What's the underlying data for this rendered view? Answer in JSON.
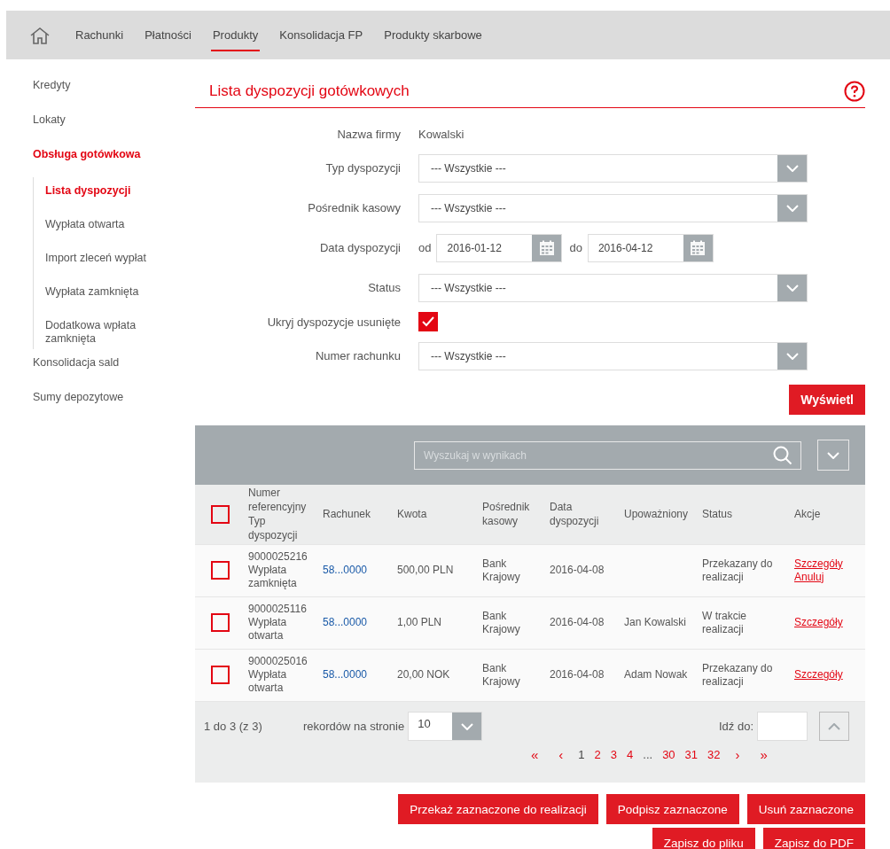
{
  "nav": {
    "tabs": [
      {
        "label": "Rachunki",
        "selected": false
      },
      {
        "label": "Płatności",
        "selected": false
      },
      {
        "label": "Produkty",
        "selected": true
      },
      {
        "label": "Konsolidacja FP",
        "selected": false
      },
      {
        "label": "Produkty skarbowe",
        "selected": false
      }
    ]
  },
  "sidebar": {
    "items": [
      {
        "label": "Kredyty",
        "selected": false
      },
      {
        "label": "Lokaty",
        "selected": false
      },
      {
        "label": "Obsługa gotówkowa",
        "selected": true,
        "expanded": true,
        "children": [
          {
            "label": "Lista dyspozycji",
            "selected": true
          },
          {
            "label": "Wypłata otwarta",
            "selected": false
          },
          {
            "label": "Import zleceń wypłat",
            "selected": false
          },
          {
            "label": "Wypłata zamknięta",
            "selected": false
          },
          {
            "label": "Dodatkowa wpłata zamknięta",
            "selected": false
          }
        ]
      },
      {
        "label": "Konsolidacja sald",
        "selected": false
      },
      {
        "label": "Sumy depozytowe",
        "selected": false
      }
    ]
  },
  "page_title": "Lista dyspozycji gotówkowych",
  "form": {
    "fields": [
      {
        "kind": "text",
        "label": "Nazwa firmy",
        "value": "Kowalski"
      },
      {
        "kind": "select",
        "label": "Typ dyspozycji",
        "value": "--- Wszystkie ---"
      },
      {
        "kind": "select",
        "label": "Pośrednik kasowy",
        "value": "--- Wszystkie ---"
      },
      {
        "kind": "daterange",
        "label": "Data dyspozycji",
        "from_label": "od",
        "from": "2016-01-12",
        "to_label": "do",
        "to": "2016-04-12"
      },
      {
        "kind": "select",
        "label": "Status",
        "value": "--- Wszystkie ---"
      },
      {
        "kind": "checkbox",
        "label": "Ukryj dyspozycje usunięte",
        "checked": true
      },
      {
        "kind": "select",
        "label": "Numer rachunku",
        "value": "--- Wszystkie ---"
      }
    ],
    "submit": "Wyświetl"
  },
  "results": {
    "search": {
      "placeholder": "Wyszukaj w wynikach"
    },
    "columns": [
      "Numer referencyjny Typ dyspozycji",
      "Rachunek",
      "Kwota",
      "Pośrednik kasowy",
      "Data dyspozycji",
      "Upoważniony",
      "Status",
      "Akcje"
    ],
    "header_checked": false,
    "rows": [
      {
        "checked": false,
        "reference": "9000025216",
        "type": "Wypłata zamknięta",
        "account": "58...0000",
        "amount": "500,00 PLN",
        "intermediary": "Bank Krajowy",
        "date": "2016-04-08",
        "authorized": "",
        "status": "Przekazany do realizacji",
        "actions": [
          "Szczegóły",
          "Anuluj"
        ]
      },
      {
        "checked": false,
        "reference": "9000025116",
        "type": "Wypłata otwarta",
        "account": "58...0000",
        "amount": "1,00 PLN",
        "intermediary": "Bank Krajowy",
        "date": "2016-04-08",
        "authorized": "Jan Kowalski",
        "status": "W trakcie realizacji",
        "actions": [
          "Szczegóły"
        ]
      },
      {
        "checked": false,
        "reference": "9000025016",
        "type": "Wypłata otwarta",
        "account": "58...0000",
        "amount": "20,00 NOK",
        "intermediary": "Bank Krajowy",
        "date": "2016-04-08",
        "authorized": "Adam Nowak",
        "status": "Przekazany do realizacji",
        "actions": [
          "Szczegóły"
        ]
      }
    ],
    "summary": "1 do 3 (z 3)",
    "per_page_label": "rekordów na stronie",
    "per_page": "10",
    "goto_label": "Idź do:",
    "pages": [
      {
        "label": "«",
        "kind": "first"
      },
      {
        "label": "‹",
        "kind": "prev"
      },
      {
        "label": "1",
        "kind": "page",
        "selected": true
      },
      {
        "label": "2",
        "kind": "page",
        "selected": false
      },
      {
        "label": "3",
        "kind": "page",
        "selected": false
      },
      {
        "label": "4",
        "kind": "page",
        "selected": false
      },
      {
        "label": "...",
        "kind": "gap"
      },
      {
        "label": "30",
        "kind": "page",
        "selected": false
      },
      {
        "label": "31",
        "kind": "page",
        "selected": false
      },
      {
        "label": "32",
        "kind": "page",
        "selected": false
      },
      {
        "label": "›",
        "kind": "next"
      },
      {
        "label": "»",
        "kind": "last"
      }
    ]
  },
  "actions": [
    [
      "Przekaż zaznaczone do realizacji",
      "Podpisz zaznaczone",
      "Usuń zaznaczone"
    ],
    [
      "Zapisz do pliku",
      "Zapisz do PDF"
    ]
  ]
}
